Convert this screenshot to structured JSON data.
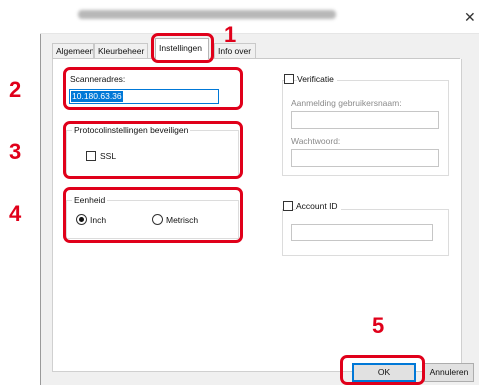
{
  "window": {
    "title_blurred": ""
  },
  "tabs": [
    {
      "label": "Algemeen"
    },
    {
      "label": "Kleurbeheer"
    },
    {
      "label": "Instellingen"
    },
    {
      "label": "Info over"
    }
  ],
  "scanner": {
    "label": "Scanneradres:",
    "value": "10.180.63.36"
  },
  "security": {
    "group_label": "Protocolinstellingen beveiligen",
    "ssl_label": "SSL"
  },
  "unit": {
    "group_label": "Eenheid",
    "inch_label": "Inch",
    "metric_label": "Metrisch",
    "selected": "Inch"
  },
  "verification": {
    "label": "Verificatie",
    "login_label": "Aanmelding gebruikersnaam:",
    "password_label": "Wachtwoord:"
  },
  "account": {
    "label": "Account ID"
  },
  "buttons": {
    "ok": "OK",
    "cancel": "Annuleren"
  },
  "callouts": {
    "n1": "1",
    "n2": "2",
    "n3": "3",
    "n4": "4",
    "n5": "5"
  },
  "colors": {
    "callout_red": "#e0001a",
    "selection_blue": "#0078d7",
    "dialog_bg": "#f0f0f0"
  }
}
